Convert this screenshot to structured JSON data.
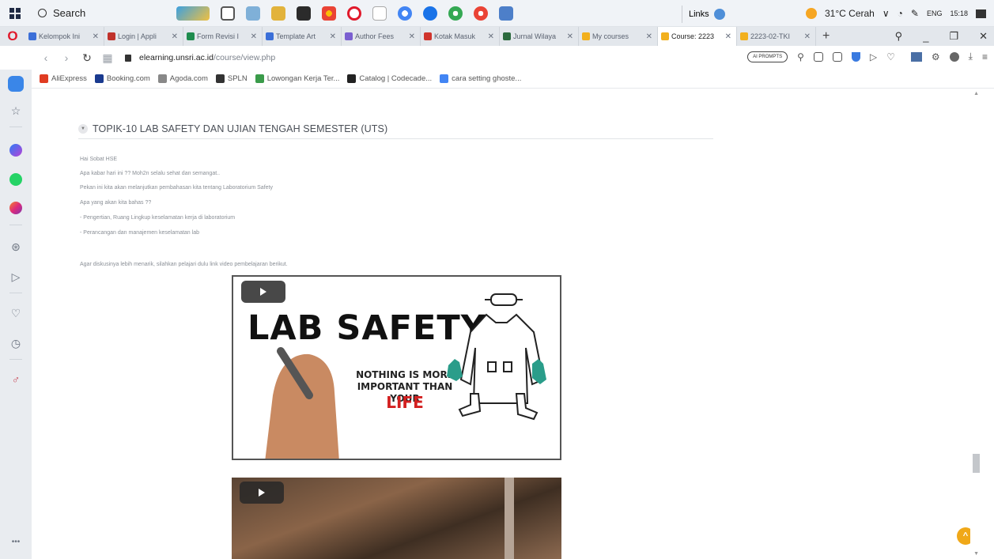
{
  "taskbar": {
    "search_placeholder": "Search",
    "links_label": "Links",
    "weather": "31°C Cerah",
    "lang": "ENG",
    "time": "15:18"
  },
  "tabs": [
    {
      "label": "Kelompok Ini",
      "color": "#3b6fd8"
    },
    {
      "label": "Login | Appli",
      "color": "#c0322b"
    },
    {
      "label": "Form Revisi I",
      "color": "#1f8c4e"
    },
    {
      "label": "Template Art",
      "color": "#3b6fd8"
    },
    {
      "label": "Author Fees",
      "color": "#7a5fd0"
    },
    {
      "label": "Kotak Masuk",
      "color": "#d0342c"
    },
    {
      "label": "Jurnal Wilaya",
      "color": "#2c6a3e"
    },
    {
      "label": "My courses",
      "color": "#f2b01e"
    },
    {
      "label": "Course: 2223",
      "color": "#f2b01e",
      "active": true
    },
    {
      "label": "2223-02-TKI",
      "color": "#f2b01e"
    }
  ],
  "address": {
    "host": "elearning.unsri.ac.id",
    "path": "/course/view.php",
    "ai_label": "AI PROMPTS"
  },
  "bookmarks": [
    {
      "label": "AliExpress",
      "color": "#e03c22"
    },
    {
      "label": "Booking.com",
      "color": "#1a3a8f"
    },
    {
      "label": "Agoda.com",
      "color": "#888888"
    },
    {
      "label": "SPLN",
      "color": "#333333"
    },
    {
      "label": "Lowongan Kerja Ter...",
      "color": "#3a9b4a"
    },
    {
      "label": "Catalog | Codecade...",
      "color": "#222222"
    },
    {
      "label": "cara setting ghoste...",
      "color": "#4285f4"
    }
  ],
  "section": {
    "title": "TOPIK-10 LAB SAFETY DAN UJIAN TENGAH SEMESTER (UTS)",
    "lines": [
      "Hai Sobat HSE",
      "Apa kabar hari ini ?? Moh2n selalu sehat dan semangat..",
      "Pekan ini kita akan melanjutkan pembahasan kita tentang Laboratorium Safety",
      "Apa yang akan kita bahas ??",
      "- Pengertian, Ruang Lingkup keselamatan kerja di laboratorium",
      "- Perancangan dan manajemen keselamatan lab"
    ],
    "intro_video": "Agar diskusinya lebih menarik, silahkan pelajari dulu link video pembelajaran berikut."
  },
  "video1": {
    "title": "LAB SAFETY",
    "subtitle": "NOTHING IS MORE IMPORTANT THAN YOUR",
    "emphasis": "LIFE"
  }
}
